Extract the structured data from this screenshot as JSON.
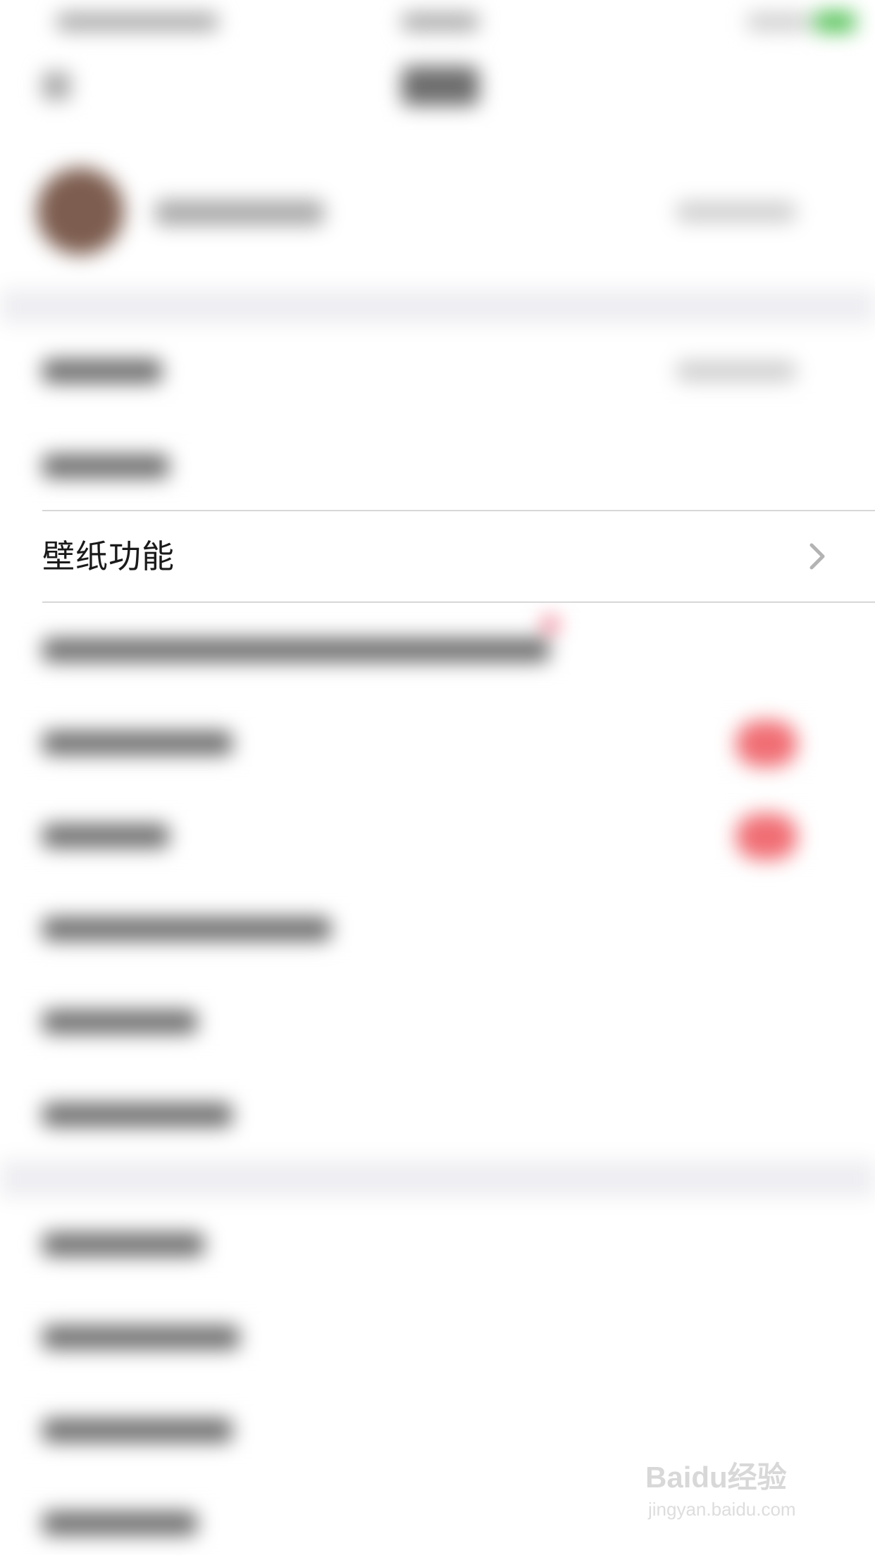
{
  "main": {
    "wallpaper_label": "壁纸功能"
  },
  "icons": {
    "chevron": "chevron-right-icon"
  },
  "colors": {
    "toggle_on": "#f06e74",
    "status_battery": "#57c35a",
    "background": "#ffffff",
    "section_gap": "#eeeef2"
  },
  "watermark": {
    "logo": "Baidu经验",
    "url": "jingyan.baidu.com"
  }
}
